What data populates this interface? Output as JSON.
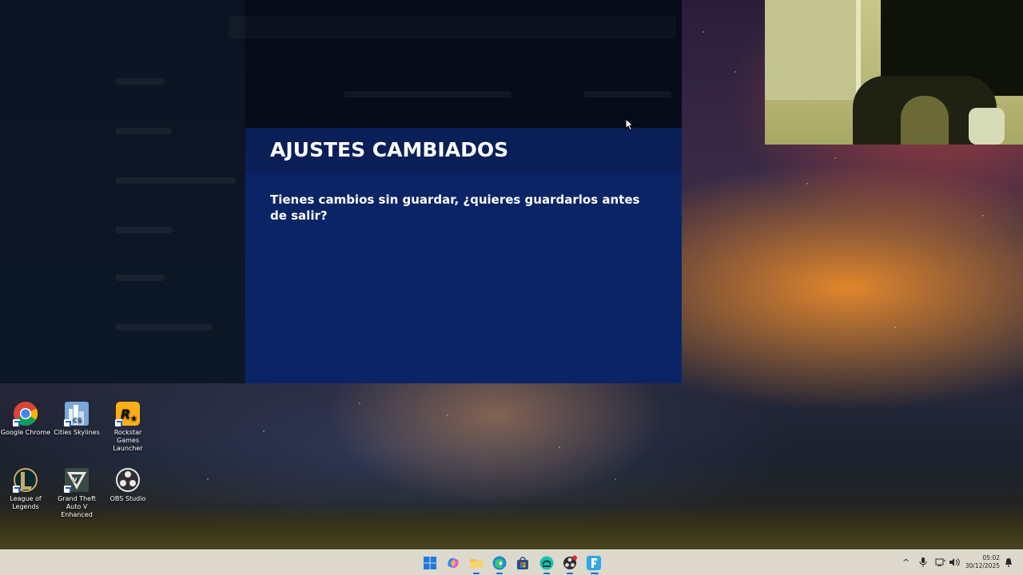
{
  "dialog": {
    "title": "AJUSTES CAMBIADOS",
    "message": "Tienes cambios sin guardar, ¿quieres guardarlos antes de salir?"
  },
  "desktop_icons": [
    {
      "label": "Google Chrome",
      "icon": "chrome-icon"
    },
    {
      "label": "Cities Skylines",
      "icon": "cities-skylines-icon"
    },
    {
      "label": "Rockstar Games Launcher",
      "icon": "rockstar-launcher-icon"
    },
    {
      "label": "League of Legends",
      "icon": "league-of-legends-icon"
    },
    {
      "label": "Grand Theft Auto V Enhanced",
      "icon": "gta-v-icon"
    },
    {
      "label": "OBS Studio",
      "icon": "obs-studio-icon"
    }
  ],
  "taskbar": {
    "apps": [
      {
        "name": "start",
        "icon": "windows-start-icon"
      },
      {
        "name": "copilot",
        "icon": "copilot-icon"
      },
      {
        "name": "file-explorer",
        "icon": "folder-icon"
      },
      {
        "name": "edge",
        "icon": "edge-icon"
      },
      {
        "name": "store",
        "icon": "store-icon"
      },
      {
        "name": "app-teal",
        "icon": "teal-app-icon"
      },
      {
        "name": "obs",
        "icon": "obs-icon"
      },
      {
        "name": "fortnite",
        "icon": "fortnite-icon"
      }
    ],
    "tray": {
      "chevron": "^",
      "time": "05:02",
      "date": "30/12/2025"
    }
  },
  "colors": {
    "dialog_bg": "#0b2466",
    "dialog_header_bg": "#0a1f57",
    "overlay_bg": "#060b1a"
  }
}
